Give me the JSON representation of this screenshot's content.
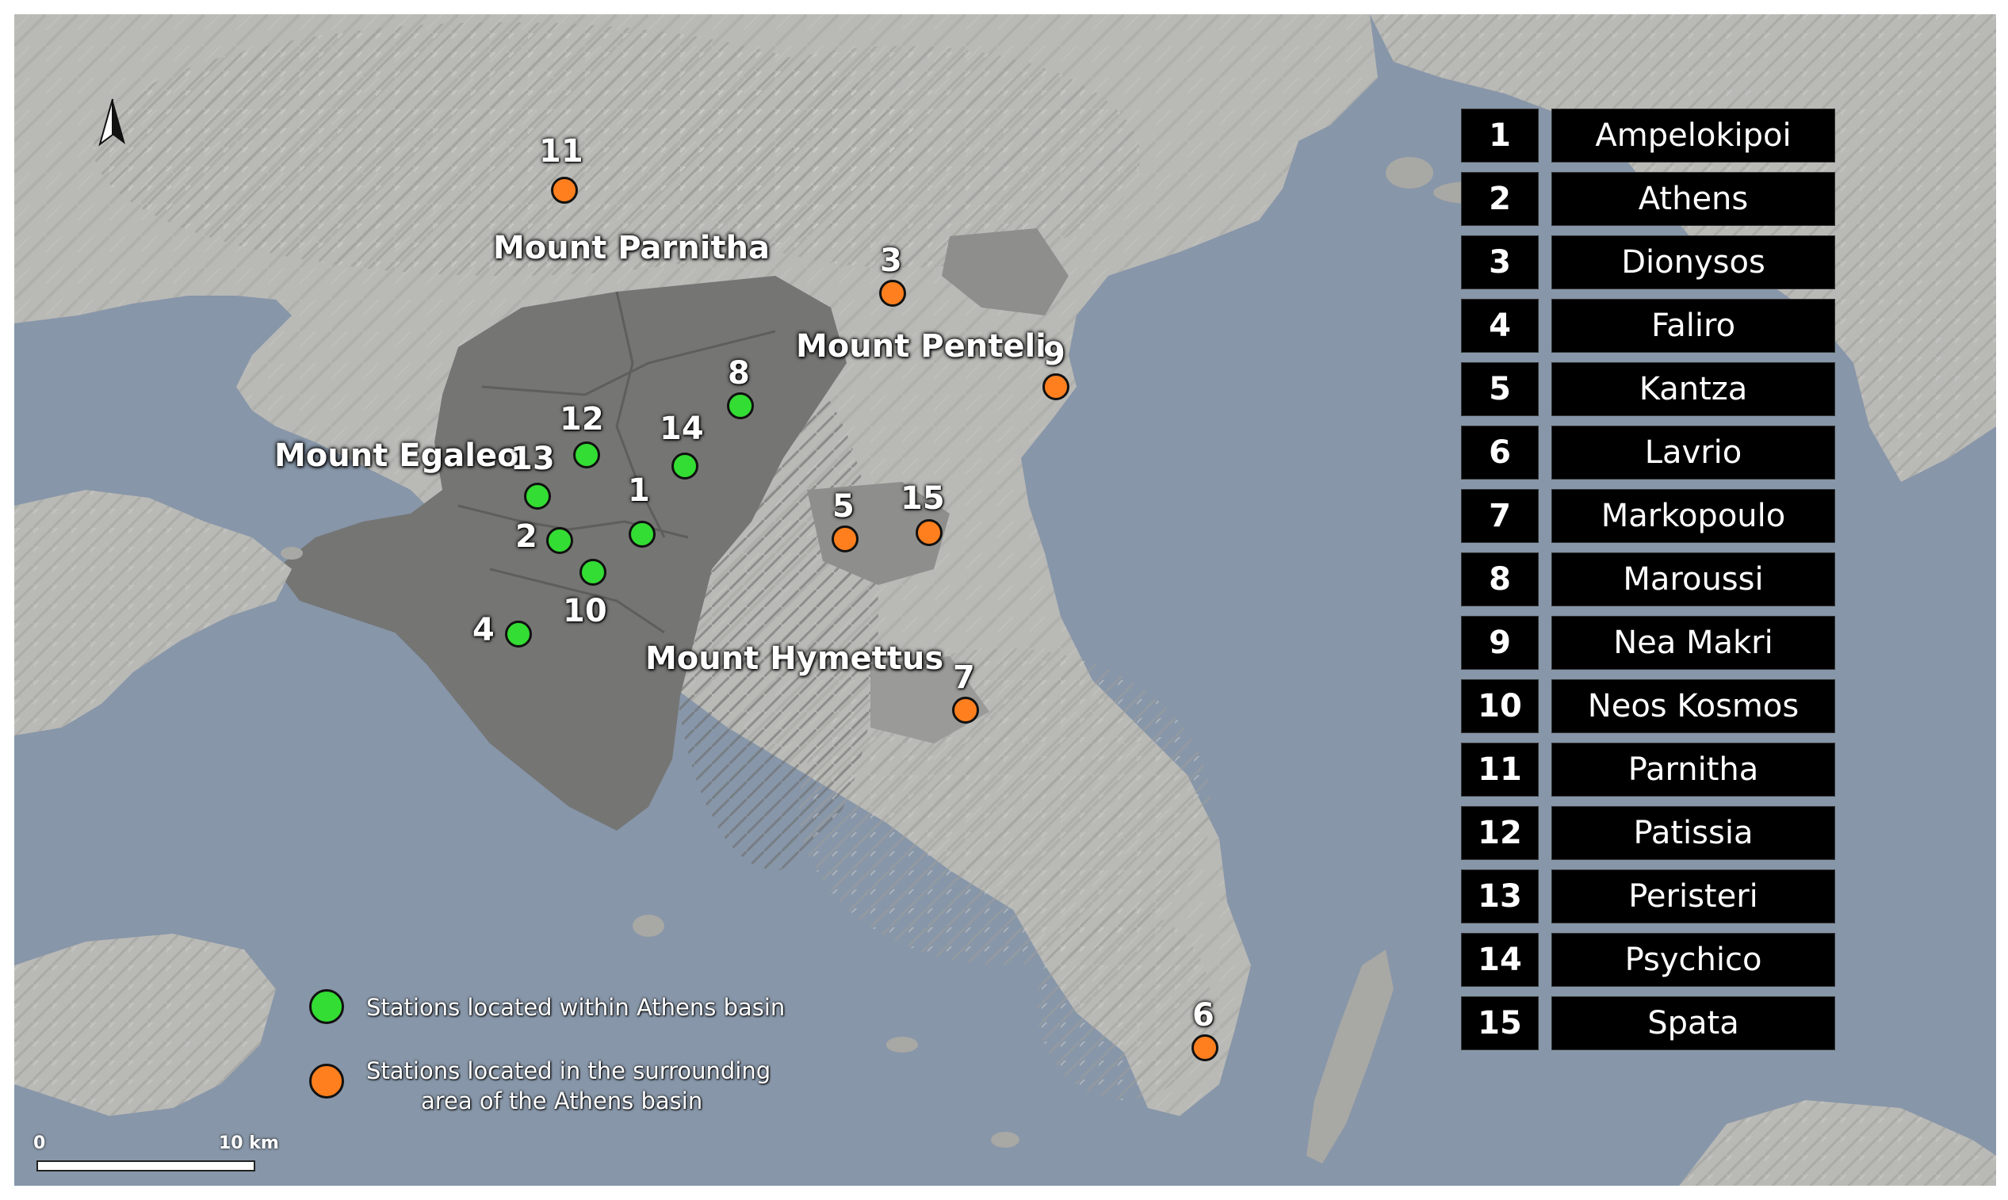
{
  "map": {
    "colors": {
      "sea": "#8796a8",
      "land": "#b9b9b6",
      "basin": "#757574",
      "within_basin": "#33dd33",
      "surrounding_area": "#ff7f1e"
    },
    "north_arrow": "north-arrow-icon"
  },
  "mountains": [
    {
      "label": "Mount Parnitha"
    },
    {
      "label": "Mount Penteli"
    },
    {
      "label": "Mount Egaleo"
    },
    {
      "label": "Mount Hymettus"
    }
  ],
  "stations": [
    {
      "num": "1",
      "name": "Ampelokipoi",
      "group": "within"
    },
    {
      "num": "2",
      "name": "Athens",
      "group": "within"
    },
    {
      "num": "3",
      "name": "Dionysos",
      "group": "surrounding"
    },
    {
      "num": "4",
      "name": "Faliro",
      "group": "within"
    },
    {
      "num": "5",
      "name": "Kantza",
      "group": "surrounding"
    },
    {
      "num": "6",
      "name": "Lavrio",
      "group": "surrounding"
    },
    {
      "num": "7",
      "name": "Markopoulo",
      "group": "surrounding"
    },
    {
      "num": "8",
      "name": "Maroussi",
      "group": "within"
    },
    {
      "num": "9",
      "name": "Nea Makri",
      "group": "surrounding"
    },
    {
      "num": "10",
      "name": "Neos Kosmos",
      "group": "within"
    },
    {
      "num": "11",
      "name": "Parnitha",
      "group": "surrounding"
    },
    {
      "num": "12",
      "name": "Patissia",
      "group": "within"
    },
    {
      "num": "13",
      "name": "Peristeri",
      "group": "within"
    },
    {
      "num": "14",
      "name": "Psychico",
      "group": "within"
    },
    {
      "num": "15",
      "name": "Spata",
      "group": "surrounding"
    }
  ],
  "legend": {
    "within": "Stations located within Athens basin",
    "surrounding_line1": "Stations located in the surrounding",
    "surrounding_line2": "area of the Athens basin"
  },
  "scale": {
    "start": "0",
    "end": "10 km"
  }
}
